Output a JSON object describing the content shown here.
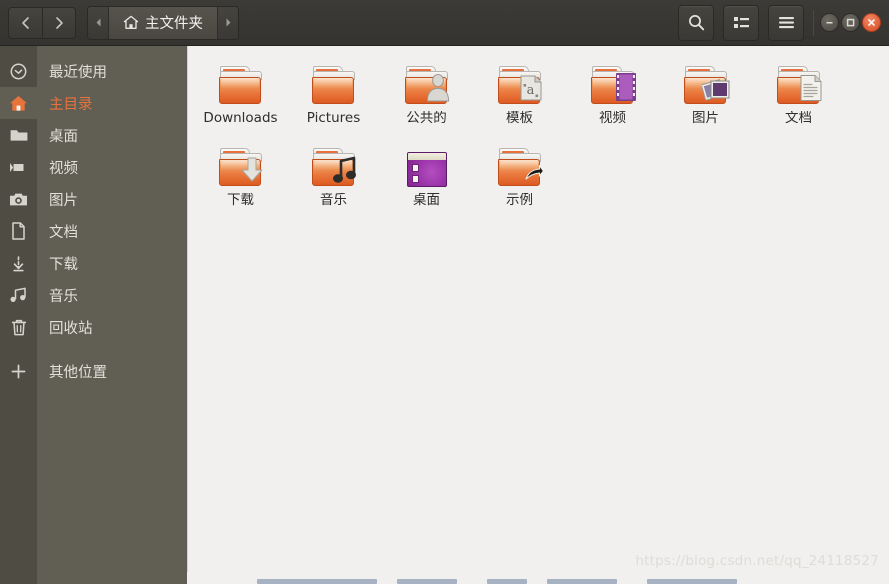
{
  "window": {
    "title": "主文件夹",
    "home_icon": "home-icon"
  },
  "header": {
    "back_label": "",
    "forward_label": "",
    "path_prev_label": "",
    "path_next_label": "",
    "breadcrumb": "主文件夹",
    "search_icon": "search-icon",
    "view_toggle_icon": "list-view-icon",
    "menu_icon": "hamburger-menu-icon",
    "minimize_label": "",
    "maximize_label": "",
    "close_label": "",
    "accent_color": "#e8743c",
    "close_button_color": "#e2603a"
  },
  "sidebar": {
    "items": [
      {
        "label": "最近使用",
        "icon": "clock-icon",
        "active": false
      },
      {
        "label": "主目录",
        "icon": "home-icon",
        "active": true
      },
      {
        "label": "桌面",
        "icon": "folder-icon",
        "active": false
      },
      {
        "label": "视频",
        "icon": "video-camera-icon",
        "active": false
      },
      {
        "label": "图片",
        "icon": "camera-icon",
        "active": false
      },
      {
        "label": "文档",
        "icon": "document-icon",
        "active": false
      },
      {
        "label": "下载",
        "icon": "download-icon",
        "active": false
      },
      {
        "label": "音乐",
        "icon": "music-note-icon",
        "active": false
      },
      {
        "label": "回收站",
        "icon": "trash-icon",
        "active": false
      },
      {
        "label": "其他位置",
        "icon": "plus-icon",
        "active": false
      }
    ]
  },
  "files": {
    "items": [
      {
        "name": "Downloads",
        "icon": "folder-plain-icon"
      },
      {
        "name": "Pictures",
        "icon": "folder-plain-icon"
      },
      {
        "name": "公共的",
        "icon": "folder-public-icon"
      },
      {
        "name": "模板",
        "icon": "folder-templates-icon"
      },
      {
        "name": "视频",
        "icon": "folder-videos-icon"
      },
      {
        "name": "图片",
        "icon": "folder-pictures-icon"
      },
      {
        "name": "文档",
        "icon": "folder-documents-icon"
      },
      {
        "name": "下载",
        "icon": "folder-downloads-icon"
      },
      {
        "name": "音乐",
        "icon": "folder-music-icon"
      },
      {
        "name": "桌面",
        "icon": "desktop-window-icon"
      },
      {
        "name": "示例",
        "icon": "folder-symlink-icon"
      }
    ]
  },
  "watermark": {
    "text": "https://blog.csdn.net/qq_24118527"
  }
}
